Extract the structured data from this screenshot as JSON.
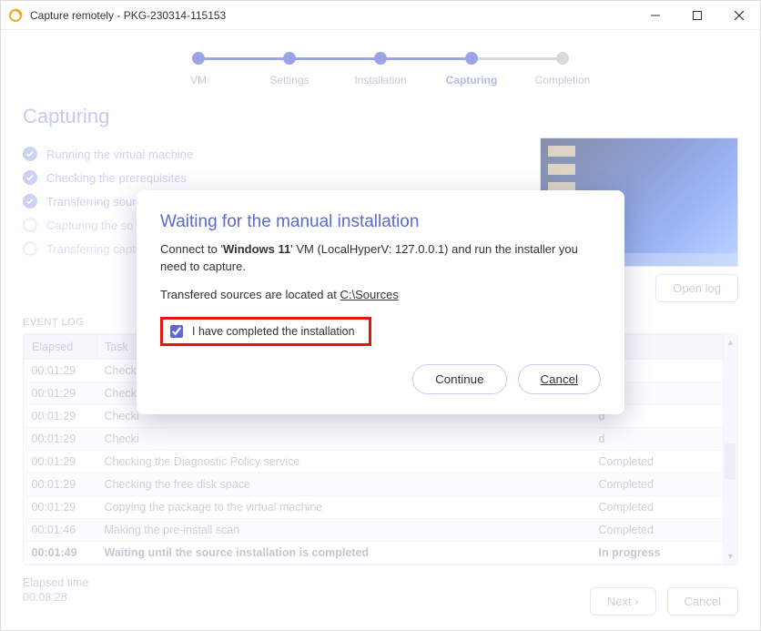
{
  "window": {
    "title": "Capture remotely - PKG-230314-115153"
  },
  "stepper": {
    "steps": [
      "VM",
      "Settings",
      "Installation",
      "Capturing",
      "Completion"
    ],
    "current_index": 3
  },
  "page": {
    "title": "Capturing",
    "checks": [
      {
        "label": "Running the virtual machine",
        "state": "done"
      },
      {
        "label": "Checking the prerequisites",
        "state": "done"
      },
      {
        "label": "Transferring sources to the virtual machine",
        "state": "done"
      },
      {
        "label": "Capturing the so",
        "state": "pending"
      },
      {
        "label": "Transferring captu",
        "state": "pending"
      }
    ],
    "open_log": "Open log"
  },
  "event_log": {
    "label": "EVENT LOG",
    "columns": {
      "elapsed": "Elapsed",
      "task": "Task",
      "status": ""
    },
    "rows": [
      {
        "elapsed": "00:01:29",
        "task": "Checki",
        "status": "d"
      },
      {
        "elapsed": "00:01:29",
        "task": "Checki",
        "status": "d"
      },
      {
        "elapsed": "00:01:29",
        "task": "Checki",
        "status": "d"
      },
      {
        "elapsed": "00:01:29",
        "task": "Checki",
        "status": "d"
      },
      {
        "elapsed": "00:01:29",
        "task": "Checking the Diagnostic Policy service",
        "status": "Completed"
      },
      {
        "elapsed": "00:01:29",
        "task": "Checking the free disk space",
        "status": "Completed"
      },
      {
        "elapsed": "00:01:29",
        "task": "Copying the package to the virtual machine",
        "status": "Completed"
      },
      {
        "elapsed": "00:01:46",
        "task": "Making the pre-install scan",
        "status": "Completed"
      },
      {
        "elapsed": "00:01:49",
        "task": "Waiting until the source installation is completed",
        "status": "In progress",
        "inprogress": true
      }
    ]
  },
  "elapsed": {
    "label": "Elapsed time",
    "value": "00:08:28"
  },
  "footer": {
    "next": "Next",
    "cancel": "Cancel"
  },
  "modal": {
    "title": "Waiting for the manual installation",
    "line1_pre": "Connect to '",
    "vm_name": "Windows 11",
    "line1_mid": "' VM (LocalHyperV: 127.0.0.1) and run the installer you need to capture.",
    "line2_pre": "Transfered sources are located at ",
    "sources_path": "C:\\Sources",
    "checkbox_label": "I have completed the installation",
    "checkbox_checked": true,
    "continue": "Continue",
    "cancel": "Cancel"
  }
}
